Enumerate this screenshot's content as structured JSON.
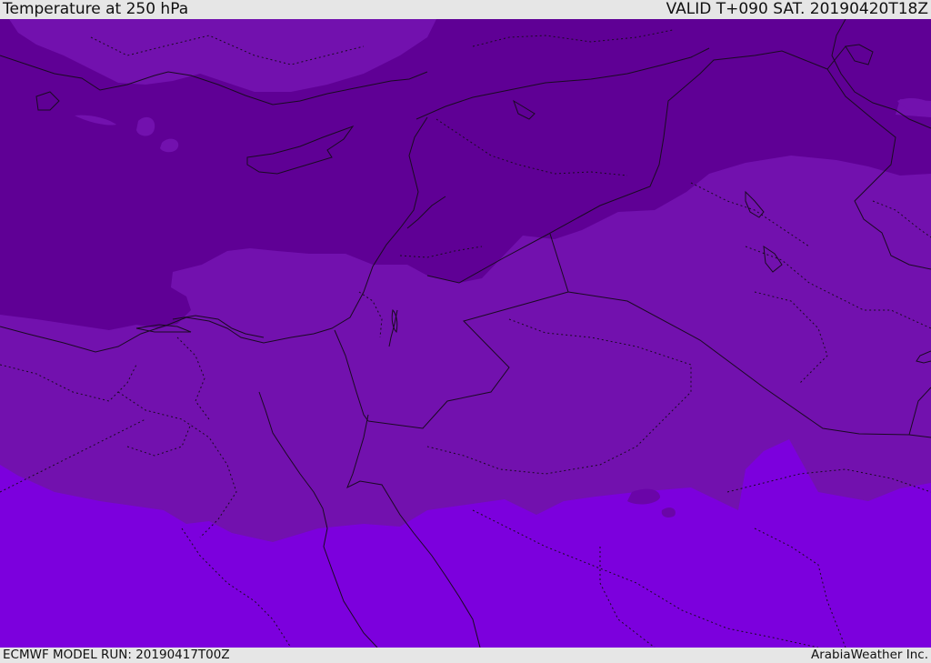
{
  "header": {
    "title": "Temperature at 250 hPa",
    "valid_time": "VALID T+090 SAT. 20190420T18Z"
  },
  "footer": {
    "model_run": "ECMWF MODEL RUN: 20190417T00Z",
    "credit": "ArabiaWeather Inc."
  },
  "map": {
    "region": "Eastern Mediterranean, Levant, Egypt and northern Arabia",
    "field": "temperature",
    "level": "250 hPa",
    "colors": {
      "coldest_band": "#5f0095",
      "middle_band": "#7211ae",
      "warmest_band": "#7c00dd",
      "small_patch": "#6a05a8",
      "coastline": "#1a0a22",
      "border": "#1a0a22"
    },
    "overlays": [
      "coastlines",
      "country borders",
      "internal boundaries"
    ],
    "legend": "none"
  }
}
